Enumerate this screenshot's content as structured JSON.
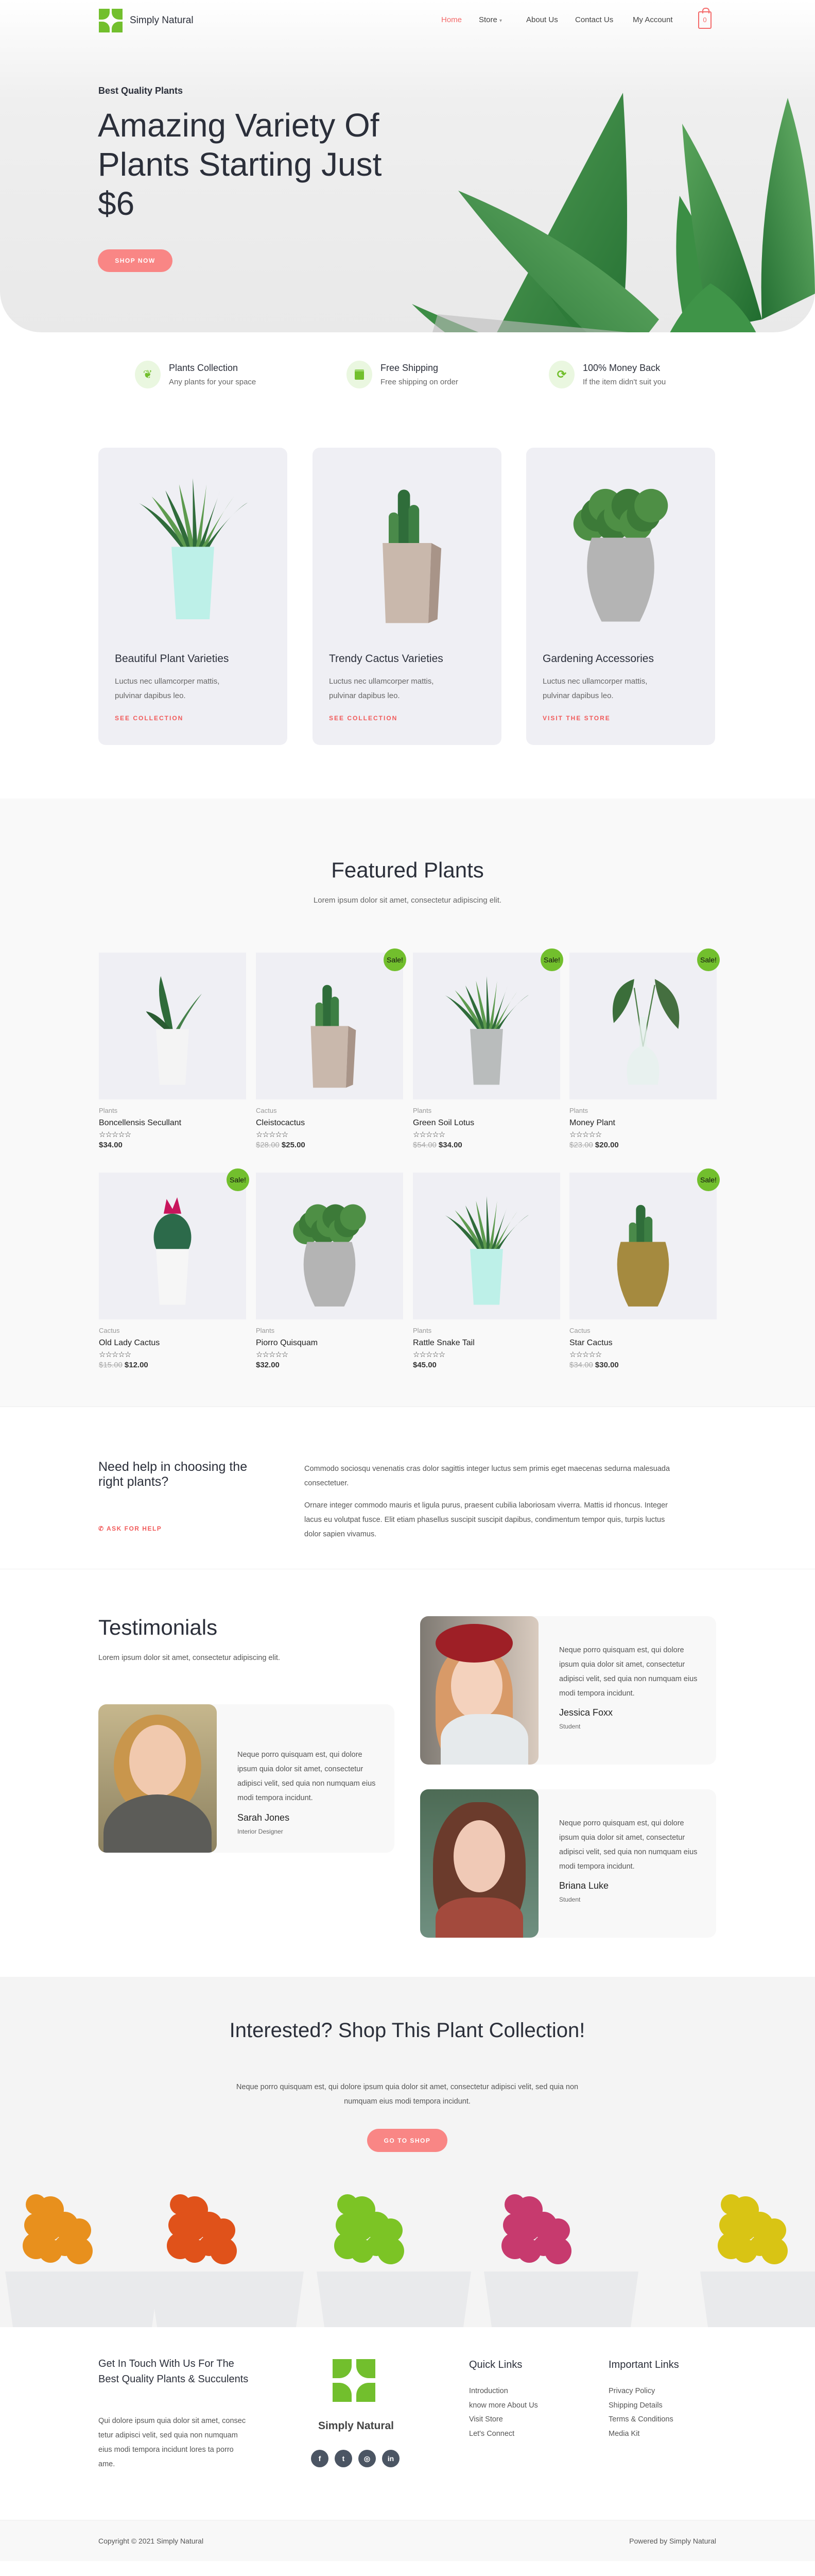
{
  "colors": {
    "accent": "#f98685",
    "link": "#f15a5a",
    "brand_green": "#72bf2d",
    "text_dark": "#2b2f3a"
  },
  "header": {
    "brand": "Simply Natural",
    "nav": [
      {
        "label": "Home",
        "active": true
      },
      {
        "label": "Store",
        "has_dropdown": true
      },
      {
        "label": "About Us"
      },
      {
        "label": "Contact Us"
      },
      {
        "label": "My Account"
      }
    ],
    "cart_count": "0",
    "store_dropdown_icon": "chevron-down-icon"
  },
  "hero": {
    "kicker": "Best Quality Plants",
    "title": "Amazing Variety Of Plants Starting Just $6",
    "button": "SHOP NOW"
  },
  "features": [
    {
      "icon": "sprout-icon",
      "title": "Plants Collection",
      "text": "Any plants for your space"
    },
    {
      "icon": "box-icon",
      "title": "Free Shipping",
      "text": "Free shipping on order"
    },
    {
      "icon": "refresh-icon",
      "title": "100% Money Back",
      "text": "If the item didn't suit you"
    }
  ],
  "categories": [
    {
      "title": "Beautiful Plant Varieties",
      "text": "Luctus nec ullamcorper mattis, pulvinar dapibus leo.",
      "link": "SEE COLLECTION"
    },
    {
      "title": "Trendy Cactus Varieties",
      "text": "Luctus nec ullamcorper mattis, pulvinar dapibus leo.",
      "link": "SEE COLLECTION"
    },
    {
      "title": "Gardening Accessories",
      "text": "Luctus nec ullamcorper mattis, pulvinar dapibus leo.",
      "link": "VISIT THE STORE"
    }
  ],
  "featured": {
    "title": "Featured Plants",
    "subtitle": "Lorem ipsum dolor sit amet, consectetur adipiscing elit.",
    "sale_label": "Sale!",
    "products": [
      {
        "category": "Plants",
        "name": "Boncellensis Secullant",
        "rating": 0,
        "old_price": "",
        "price": "$34.00",
        "sale": false
      },
      {
        "category": "Cactus",
        "name": "Cleistocactus",
        "rating": 0,
        "old_price": "$28.00",
        "price": "$25.00",
        "sale": true
      },
      {
        "category": "Plants",
        "name": "Green Soil Lotus",
        "rating": 0,
        "old_price": "$54.00",
        "price": "$34.00",
        "sale": true
      },
      {
        "category": "Plants",
        "name": "Money Plant",
        "rating": 0,
        "old_price": "$23.00",
        "price": "$20.00",
        "sale": true
      },
      {
        "category": "Cactus",
        "name": "Old Lady Cactus",
        "rating": 0,
        "old_price": "$15.00",
        "price": "$12.00",
        "sale": true
      },
      {
        "category": "Plants",
        "name": "Piorro Quisquam",
        "rating": 0,
        "old_price": "",
        "price": "$32.00",
        "sale": false
      },
      {
        "category": "Plants",
        "name": "Rattle Snake Tail",
        "rating": 0,
        "old_price": "",
        "price": "$45.00",
        "sale": false
      },
      {
        "category": "Cactus",
        "name": "Star Cactus",
        "rating": 0,
        "old_price": "$34.00",
        "price": "$30.00",
        "sale": true
      }
    ]
  },
  "help": {
    "title": "Need help in choosing the right plants?",
    "link": "ASK FOR HELP",
    "paragraphs": [
      "Commodo sociosqu venenatis cras dolor sagittis integer luctus sem primis eget maecenas sedurna malesuada consectetuer.",
      "Ornare integer commodo mauris et ligula purus, praesent cubilia laboriosam viverra. Mattis id rhoncus. Integer lacus eu volutpat fusce. Elit etiam phasellus suscipit suscipit dapibus, condimentum tempor quis, turpis luctus dolor sapien vivamus."
    ]
  },
  "testimonials": {
    "title": "Testimonials",
    "subtitle": "Lorem ipsum dolor sit amet, consectetur adipiscing elit.",
    "items": [
      {
        "quote": "Neque porro quisquam est, qui dolore ipsum quia dolor sit amet, consectetur adipisci velit, sed quia non numquam eius modi tempora incidunt.",
        "name": "Sarah Jones",
        "role": "Interior Designer"
      },
      {
        "quote": "Neque porro quisquam est, qui dolore ipsum quia dolor sit amet, consectetur adipisci velit, sed quia non numquam eius modi tempora incidunt.",
        "name": "Jessica Foxx",
        "role": "Student"
      },
      {
        "quote": "Neque porro quisquam est, qui dolore ipsum quia dolor sit amet, consectetur adipisci velit, sed quia non numquam eius modi tempora incidunt.",
        "name": "Briana Luke",
        "role": "Student"
      }
    ]
  },
  "cta": {
    "title": "Interested? Shop This Plant Collection!",
    "text": "Neque porro quisquam est, qui dolore ipsum quia dolor sit amet, consectetur adipisci velit, sed quia non numquam eius modi tempora incidunt.",
    "button": "GO TO SHOP"
  },
  "footer": {
    "contact_title": "Get In Touch With Us For The Best Quality Plants & Succulents",
    "contact_text": "Qui dolore ipsum quia dolor sit amet, consec tetur adipisci velit, sed quia non numquam eius modi tempora incidunt lores ta porro ame.",
    "brand": "Simply Natural",
    "social": [
      {
        "icon": "facebook-icon",
        "glyph": "f"
      },
      {
        "icon": "twitter-icon",
        "glyph": "t"
      },
      {
        "icon": "instagram-icon",
        "glyph": "◎"
      },
      {
        "icon": "linkedin-icon",
        "glyph": "in"
      }
    ],
    "quick_title": "Quick Links",
    "quick_links": [
      "Introduction",
      "know more About Us",
      "Visit Store",
      "Let's Connect"
    ],
    "important_title": "Important Links",
    "important_links": [
      "Privacy Policy",
      "Shipping Details",
      "Terms & Conditions",
      "Media Kit"
    ],
    "copyright": "Copyright © 2021 Simply Natural",
    "powered": "Powered by Simply Natural"
  }
}
